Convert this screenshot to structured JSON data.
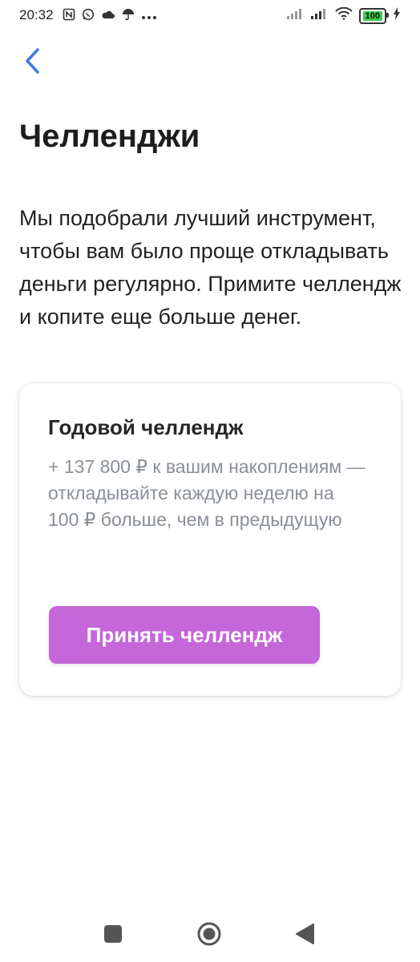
{
  "status_bar": {
    "time": "20:32",
    "battery_level": "100",
    "icons_left": [
      "nfc-icon",
      "whatsapp-icon",
      "cloud-icon",
      "umbrella-icon",
      "more-icon"
    ],
    "icons_right": [
      "signal-icon",
      "signal-icon",
      "wifi-icon",
      "battery-icon",
      "charging-icon"
    ]
  },
  "header": {
    "back_icon": "chevron-left-icon",
    "title": "Челленджи"
  },
  "intro": {
    "text": "Мы подобрали лучший инструмент, чтобы вам было проще откладывать деньги регулярно. Примите челлендж и копите еще больше денег."
  },
  "challenge_card": {
    "title": "Годовой челлендж",
    "description": "+ 137 800 ₽ к вашим накоплениям — откладывайте каждую неделю на 100 ₽ больше, чем в предыдущую",
    "button_label": "Принять челлендж"
  },
  "nav_bar": {
    "items": [
      "recents-button",
      "home-button",
      "back-button"
    ]
  },
  "colors": {
    "accent_button": "#c566d9",
    "back_arrow": "#3d7be0",
    "description_text": "#8a8f98",
    "battery": "#3cc94a"
  }
}
